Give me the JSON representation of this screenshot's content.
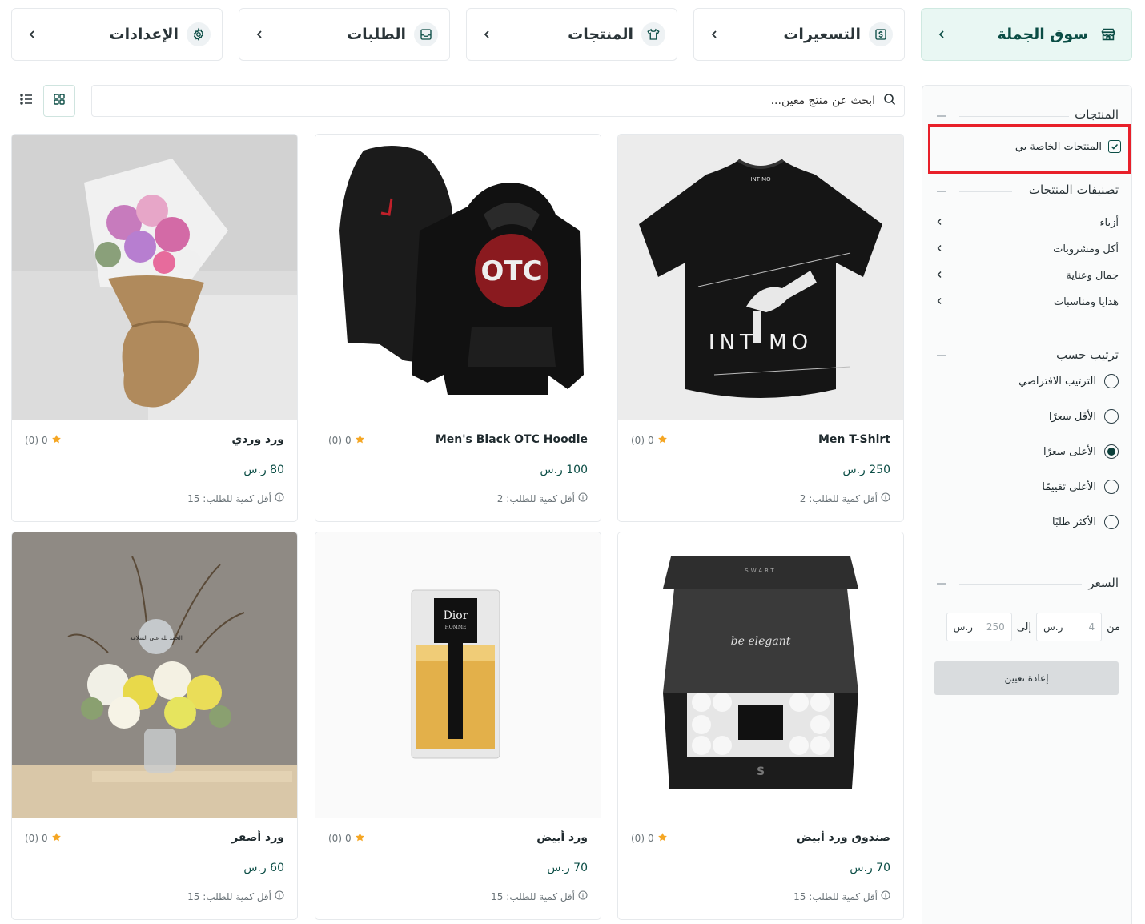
{
  "nav": {
    "items": [
      {
        "label": "سوق الجملة",
        "icon": "store-icon",
        "active": true
      },
      {
        "label": "التسعيرات",
        "icon": "pricing-icon",
        "active": false
      },
      {
        "label": "المنتجات",
        "icon": "shirt-icon",
        "active": false
      },
      {
        "label": "الطلبات",
        "icon": "inbox-icon",
        "active": false
      },
      {
        "label": "الإعدادات",
        "icon": "gear-icon",
        "active": false
      }
    ]
  },
  "search": {
    "placeholder": "ابحث عن منتج معين..."
  },
  "sidebar": {
    "products_title": "المنتجات",
    "my_products_label": "المنتجات الخاصة بي",
    "my_products_checked": true,
    "categories_title": "تصنيفات المنتجات",
    "categories": [
      {
        "label": "أزياء"
      },
      {
        "label": "أكل ومشروبات"
      },
      {
        "label": "جمال وعناية"
      },
      {
        "label": "هدايا ومناسبات"
      }
    ],
    "sort_title": "ترتيب حسب",
    "sort_options": [
      {
        "label": "الترتيب الافتراضي",
        "selected": false
      },
      {
        "label": "الأقل سعرًا",
        "selected": false
      },
      {
        "label": "الأعلى سعرًا",
        "selected": true
      },
      {
        "label": "الأعلى تقييمًا",
        "selected": false
      },
      {
        "label": "الأكثر طلبًا",
        "selected": false
      }
    ],
    "price_title": "السعر",
    "price_from_label": "من",
    "price_to_label": "إلى",
    "price_min": "4",
    "price_max": "250",
    "currency": "ر.س",
    "reset_label": "إعادة تعيين"
  },
  "products": [
    {
      "name": "Men T-Shirt",
      "price": "250 ر.س",
      "rating": "0",
      "reviews": "(0)",
      "min_order": "أقل كمية للطلب: 2"
    },
    {
      "name": "Men's Black OTC Hoodie",
      "price": "100 ر.س",
      "rating": "0",
      "reviews": "(0)",
      "min_order": "أقل كمية للطلب: 2"
    },
    {
      "name": "ورد وردي",
      "price": "80 ر.س",
      "rating": "0",
      "reviews": "(0)",
      "min_order": "أقل كمية للطلب: 15"
    },
    {
      "name": "صندوق ورد أبيض",
      "price": "70 ر.س",
      "rating": "0",
      "reviews": "(0)",
      "min_order": "أقل كمية للطلب: 15"
    },
    {
      "name": "ورد أبيض",
      "price": "70 ر.س",
      "rating": "0",
      "reviews": "(0)",
      "min_order": "أقل كمية للطلب: 15"
    },
    {
      "name": "ورد أصفر",
      "price": "60 ر.س",
      "rating": "0",
      "reviews": "(0)",
      "min_order": "أقل كمية للطلب: 15"
    }
  ],
  "image_text": {
    "tshirt_brand": "INT MO",
    "hoodie_logo": "OTC",
    "perfume_brand": "Dior",
    "perfume_sub": "HOMME",
    "box_brand": "SWART",
    "box_script": "be elegant",
    "flower_sign": "الحمد لله على السلامة"
  },
  "colors": {
    "accent": "#0b4d45",
    "active_nav_bg": "#e9f7f3",
    "highlight": "#e8202a",
    "star": "#f5a623"
  }
}
